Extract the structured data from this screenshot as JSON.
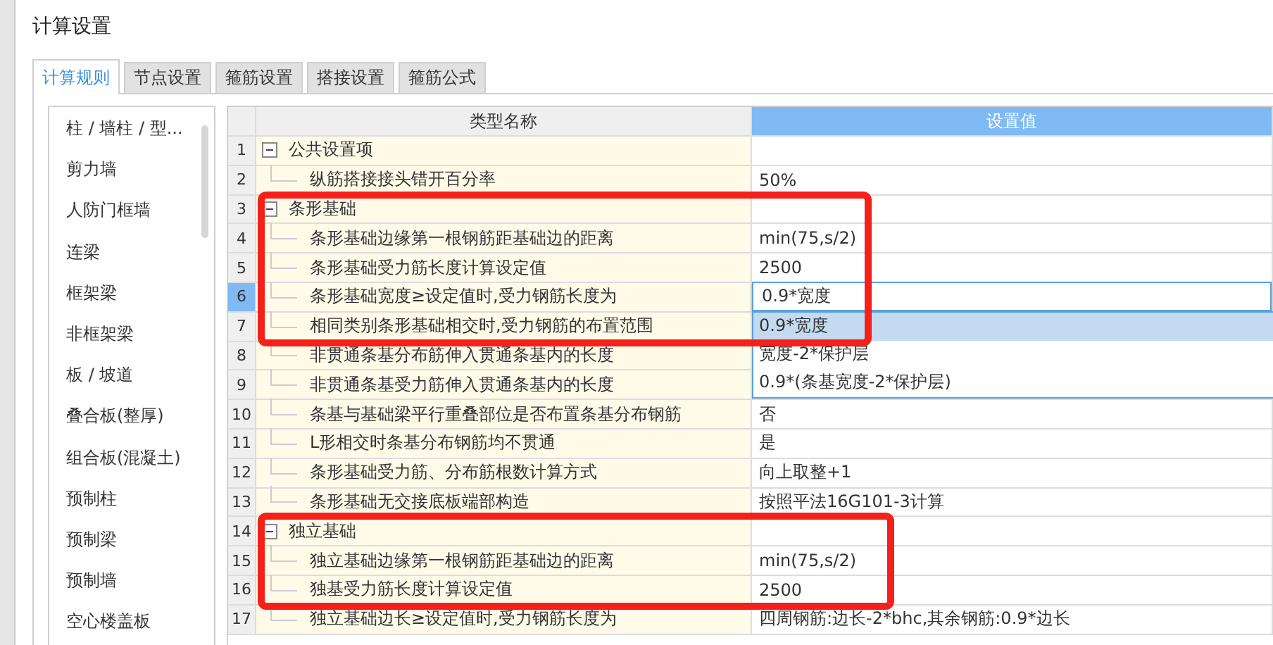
{
  "window": {
    "title": "计算设置"
  },
  "tabs": [
    {
      "label": "计算规则",
      "selected": true
    },
    {
      "label": "节点设置",
      "selected": false
    },
    {
      "label": "箍筋设置",
      "selected": false
    },
    {
      "label": "搭接设置",
      "selected": false
    },
    {
      "label": "箍筋公式",
      "selected": false
    }
  ],
  "sidebar": {
    "items": [
      "柱 / 墙柱 / 型...",
      "剪力墙",
      "人防门框墙",
      "连梁",
      "框架梁",
      "非框架梁",
      "板 / 坡道",
      "叠合板(整厚)",
      "组合板(混凝土)",
      "预制柱",
      "预制梁",
      "预制墙",
      "空心楼盖板"
    ]
  },
  "table": {
    "columns": [
      {
        "label": "类型名称",
        "selected": false
      },
      {
        "label": "设置值",
        "selected": true
      }
    ],
    "rows": [
      {
        "number": "1",
        "kind": "group",
        "name": "公共设置项",
        "expanded": true,
        "selected": false,
        "framed": false
      },
      {
        "number": "2",
        "kind": "item",
        "name": "纵筋搭接接头错开百分率",
        "value": "50%",
        "selected": false,
        "framed": false
      },
      {
        "number": "3",
        "kind": "group",
        "name": "条形基础",
        "expanded": true,
        "selected": false,
        "framed": true
      },
      {
        "number": "4",
        "kind": "item",
        "name": "条形基础边缘第一根钢筋距基础边的距离",
        "value": "min(75,s/2)",
        "selected": false,
        "framed": true
      },
      {
        "number": "5",
        "kind": "item",
        "name": "条形基础受力筋长度计算设定值",
        "value": "2500",
        "selected": false,
        "framed": true
      },
      {
        "number": "6",
        "kind": "item",
        "name": "条形基础宽度≥设定值时,受力钢筋长度为",
        "value": "0.9*宽度",
        "selected": true,
        "framed": true,
        "open": true,
        "options": [
          {
            "label": "0.9*宽度",
            "selected": true
          },
          {
            "label": "宽度-2*保护层",
            "selected": false
          },
          {
            "label": "0.9*(条基宽度-2*保护层)",
            "selected": false
          }
        ]
      },
      {
        "number": "7",
        "kind": "item",
        "name": "相同类别条形基础相交时,受力钢筋的布置范围",
        "selected": false,
        "framed": true
      },
      {
        "number": "8",
        "kind": "item",
        "name": "非贯通条基分布筋伸入贯通条基内的长度",
        "selected": false,
        "framed": false
      },
      {
        "number": "9",
        "kind": "item",
        "name": "非贯通条基受力筋伸入贯通条基内的长度",
        "selected": false,
        "framed": false
      },
      {
        "number": "10",
        "kind": "item",
        "name": "条基与基础梁平行重叠部位是否布置条基分布钢筋",
        "value": "否",
        "selected": false,
        "framed": false
      },
      {
        "number": "11",
        "kind": "item",
        "name": "L形相交时条基分布钢筋均不贯通",
        "value": "是",
        "selected": false,
        "framed": false
      },
      {
        "number": "12",
        "kind": "item",
        "name": "条形基础受力筋、分布筋根数计算方式",
        "value": "向上取整+1",
        "selected": false,
        "framed": false
      },
      {
        "number": "13",
        "kind": "item",
        "name": "条形基础无交接底板端部构造",
        "value": "按照平法16G101-3计算",
        "selected": false,
        "framed": false
      },
      {
        "number": "14",
        "kind": "group",
        "name": "独立基础",
        "expanded": true,
        "selected": false,
        "framed": true
      },
      {
        "number": "15",
        "kind": "item",
        "name": "独立基础边缘第一根钢筋距基础边的距离",
        "value": "min(75,s/2)",
        "selected": false,
        "framed": true
      },
      {
        "number": "16",
        "kind": "item",
        "name": "独基受力筋长度计算设定值",
        "value": "2500",
        "selected": false,
        "framed": true
      },
      {
        "number": "17",
        "kind": "item",
        "name": "独立基础边长≥设定值时,受力钢筋长度为",
        "value": "四周钢筋:边长-2*bhc,其余钢筋:0.9*边长",
        "selected": false,
        "framed": false
      }
    ]
  }
}
